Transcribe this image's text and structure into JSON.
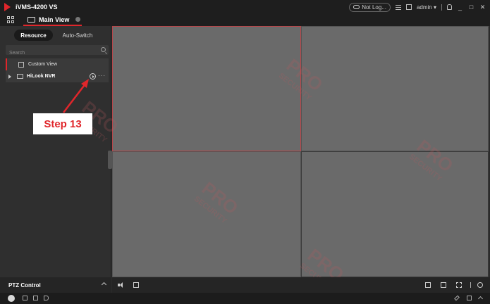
{
  "window": {
    "app_title": "iVMS-4200 VS",
    "cloud_status": "Not Log...",
    "user": "admin"
  },
  "tabs": {
    "main_view": "Main View"
  },
  "left_panel": {
    "tab_resource": "Resource",
    "tab_auto_switch": "Auto-Switch",
    "search_placeholder": "Search",
    "tree": [
      {
        "label": "Custom View"
      },
      {
        "label": "HiLook NVR"
      }
    ],
    "ptz_label": "PTZ Control"
  },
  "annotation": {
    "step_label": "Step 13"
  },
  "watermark": {
    "brand": "PRO",
    "sub": "SECURITY"
  },
  "colors": {
    "accent": "#e0262b",
    "view_bg": "#6a6a6a",
    "panel_bg": "#2f2f2f"
  },
  "layout": {
    "grid": "2x2",
    "selected_window": 1
  }
}
